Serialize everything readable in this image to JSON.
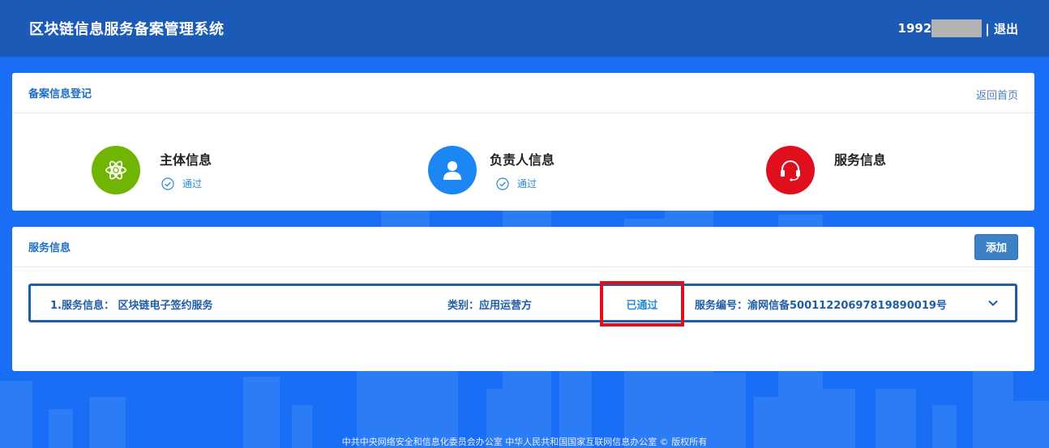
{
  "header": {
    "title": "区块链信息服务备案管理系统",
    "user_prefix": "1992",
    "logout_label": "| 退出"
  },
  "registration": {
    "title": "备案信息登记",
    "return_label": "返回首页",
    "steps": [
      {
        "label": "主体信息",
        "status": "通过",
        "icon": "atom-icon",
        "color": "#71b504"
      },
      {
        "label": "负责人信息",
        "status": "通过",
        "icon": "person-icon",
        "color": "#1c86f2"
      },
      {
        "label": "服务信息",
        "icon": "headset-icon",
        "color": "#e00f1e"
      }
    ]
  },
  "service": {
    "title": "服务信息",
    "add_label": "添加",
    "rows": [
      {
        "name": "1.服务信息：  区块链电子签约服务",
        "category": "类别：应用运营方",
        "status": "已通过",
        "number": "服务编号：渝网信备50011220697819890019号"
      }
    ]
  },
  "footer": {
    "text": "中共中央网络安全和信息化委员会办公室   中华人民共和国国家互联网信息办公室 © 版权所有"
  },
  "colors": {
    "background": "#1a6ef5",
    "topbar": "#1b5ab6",
    "accent": "#1c6fc4",
    "highlight": "#e00f1e"
  }
}
